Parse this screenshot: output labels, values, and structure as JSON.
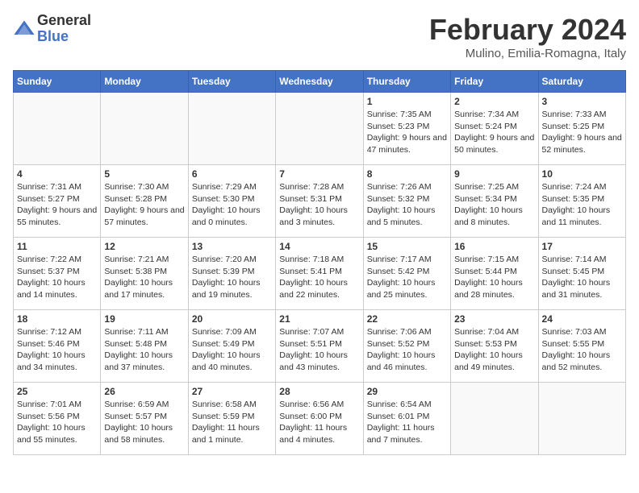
{
  "logo": {
    "general": "General",
    "blue": "Blue"
  },
  "title": "February 2024",
  "subtitle": "Mulino, Emilia-Romagna, Italy",
  "headers": [
    "Sunday",
    "Monday",
    "Tuesday",
    "Wednesday",
    "Thursday",
    "Friday",
    "Saturday"
  ],
  "weeks": [
    [
      {
        "day": "",
        "info": ""
      },
      {
        "day": "",
        "info": ""
      },
      {
        "day": "",
        "info": ""
      },
      {
        "day": "",
        "info": ""
      },
      {
        "day": "1",
        "info": "Sunrise: 7:35 AM\nSunset: 5:23 PM\nDaylight: 9 hours and 47 minutes."
      },
      {
        "day": "2",
        "info": "Sunrise: 7:34 AM\nSunset: 5:24 PM\nDaylight: 9 hours and 50 minutes."
      },
      {
        "day": "3",
        "info": "Sunrise: 7:33 AM\nSunset: 5:25 PM\nDaylight: 9 hours and 52 minutes."
      }
    ],
    [
      {
        "day": "4",
        "info": "Sunrise: 7:31 AM\nSunset: 5:27 PM\nDaylight: 9 hours and 55 minutes."
      },
      {
        "day": "5",
        "info": "Sunrise: 7:30 AM\nSunset: 5:28 PM\nDaylight: 9 hours and 57 minutes."
      },
      {
        "day": "6",
        "info": "Sunrise: 7:29 AM\nSunset: 5:30 PM\nDaylight: 10 hours and 0 minutes."
      },
      {
        "day": "7",
        "info": "Sunrise: 7:28 AM\nSunset: 5:31 PM\nDaylight: 10 hours and 3 minutes."
      },
      {
        "day": "8",
        "info": "Sunrise: 7:26 AM\nSunset: 5:32 PM\nDaylight: 10 hours and 5 minutes."
      },
      {
        "day": "9",
        "info": "Sunrise: 7:25 AM\nSunset: 5:34 PM\nDaylight: 10 hours and 8 minutes."
      },
      {
        "day": "10",
        "info": "Sunrise: 7:24 AM\nSunset: 5:35 PM\nDaylight: 10 hours and 11 minutes."
      }
    ],
    [
      {
        "day": "11",
        "info": "Sunrise: 7:22 AM\nSunset: 5:37 PM\nDaylight: 10 hours and 14 minutes."
      },
      {
        "day": "12",
        "info": "Sunrise: 7:21 AM\nSunset: 5:38 PM\nDaylight: 10 hours and 17 minutes."
      },
      {
        "day": "13",
        "info": "Sunrise: 7:20 AM\nSunset: 5:39 PM\nDaylight: 10 hours and 19 minutes."
      },
      {
        "day": "14",
        "info": "Sunrise: 7:18 AM\nSunset: 5:41 PM\nDaylight: 10 hours and 22 minutes."
      },
      {
        "day": "15",
        "info": "Sunrise: 7:17 AM\nSunset: 5:42 PM\nDaylight: 10 hours and 25 minutes."
      },
      {
        "day": "16",
        "info": "Sunrise: 7:15 AM\nSunset: 5:44 PM\nDaylight: 10 hours and 28 minutes."
      },
      {
        "day": "17",
        "info": "Sunrise: 7:14 AM\nSunset: 5:45 PM\nDaylight: 10 hours and 31 minutes."
      }
    ],
    [
      {
        "day": "18",
        "info": "Sunrise: 7:12 AM\nSunset: 5:46 PM\nDaylight: 10 hours and 34 minutes."
      },
      {
        "day": "19",
        "info": "Sunrise: 7:11 AM\nSunset: 5:48 PM\nDaylight: 10 hours and 37 minutes."
      },
      {
        "day": "20",
        "info": "Sunrise: 7:09 AM\nSunset: 5:49 PM\nDaylight: 10 hours and 40 minutes."
      },
      {
        "day": "21",
        "info": "Sunrise: 7:07 AM\nSunset: 5:51 PM\nDaylight: 10 hours and 43 minutes."
      },
      {
        "day": "22",
        "info": "Sunrise: 7:06 AM\nSunset: 5:52 PM\nDaylight: 10 hours and 46 minutes."
      },
      {
        "day": "23",
        "info": "Sunrise: 7:04 AM\nSunset: 5:53 PM\nDaylight: 10 hours and 49 minutes."
      },
      {
        "day": "24",
        "info": "Sunrise: 7:03 AM\nSunset: 5:55 PM\nDaylight: 10 hours and 52 minutes."
      }
    ],
    [
      {
        "day": "25",
        "info": "Sunrise: 7:01 AM\nSunset: 5:56 PM\nDaylight: 10 hours and 55 minutes."
      },
      {
        "day": "26",
        "info": "Sunrise: 6:59 AM\nSunset: 5:57 PM\nDaylight: 10 hours and 58 minutes."
      },
      {
        "day": "27",
        "info": "Sunrise: 6:58 AM\nSunset: 5:59 PM\nDaylight: 11 hours and 1 minute."
      },
      {
        "day": "28",
        "info": "Sunrise: 6:56 AM\nSunset: 6:00 PM\nDaylight: 11 hours and 4 minutes."
      },
      {
        "day": "29",
        "info": "Sunrise: 6:54 AM\nSunset: 6:01 PM\nDaylight: 11 hours and 7 minutes."
      },
      {
        "day": "",
        "info": ""
      },
      {
        "day": "",
        "info": ""
      }
    ]
  ]
}
